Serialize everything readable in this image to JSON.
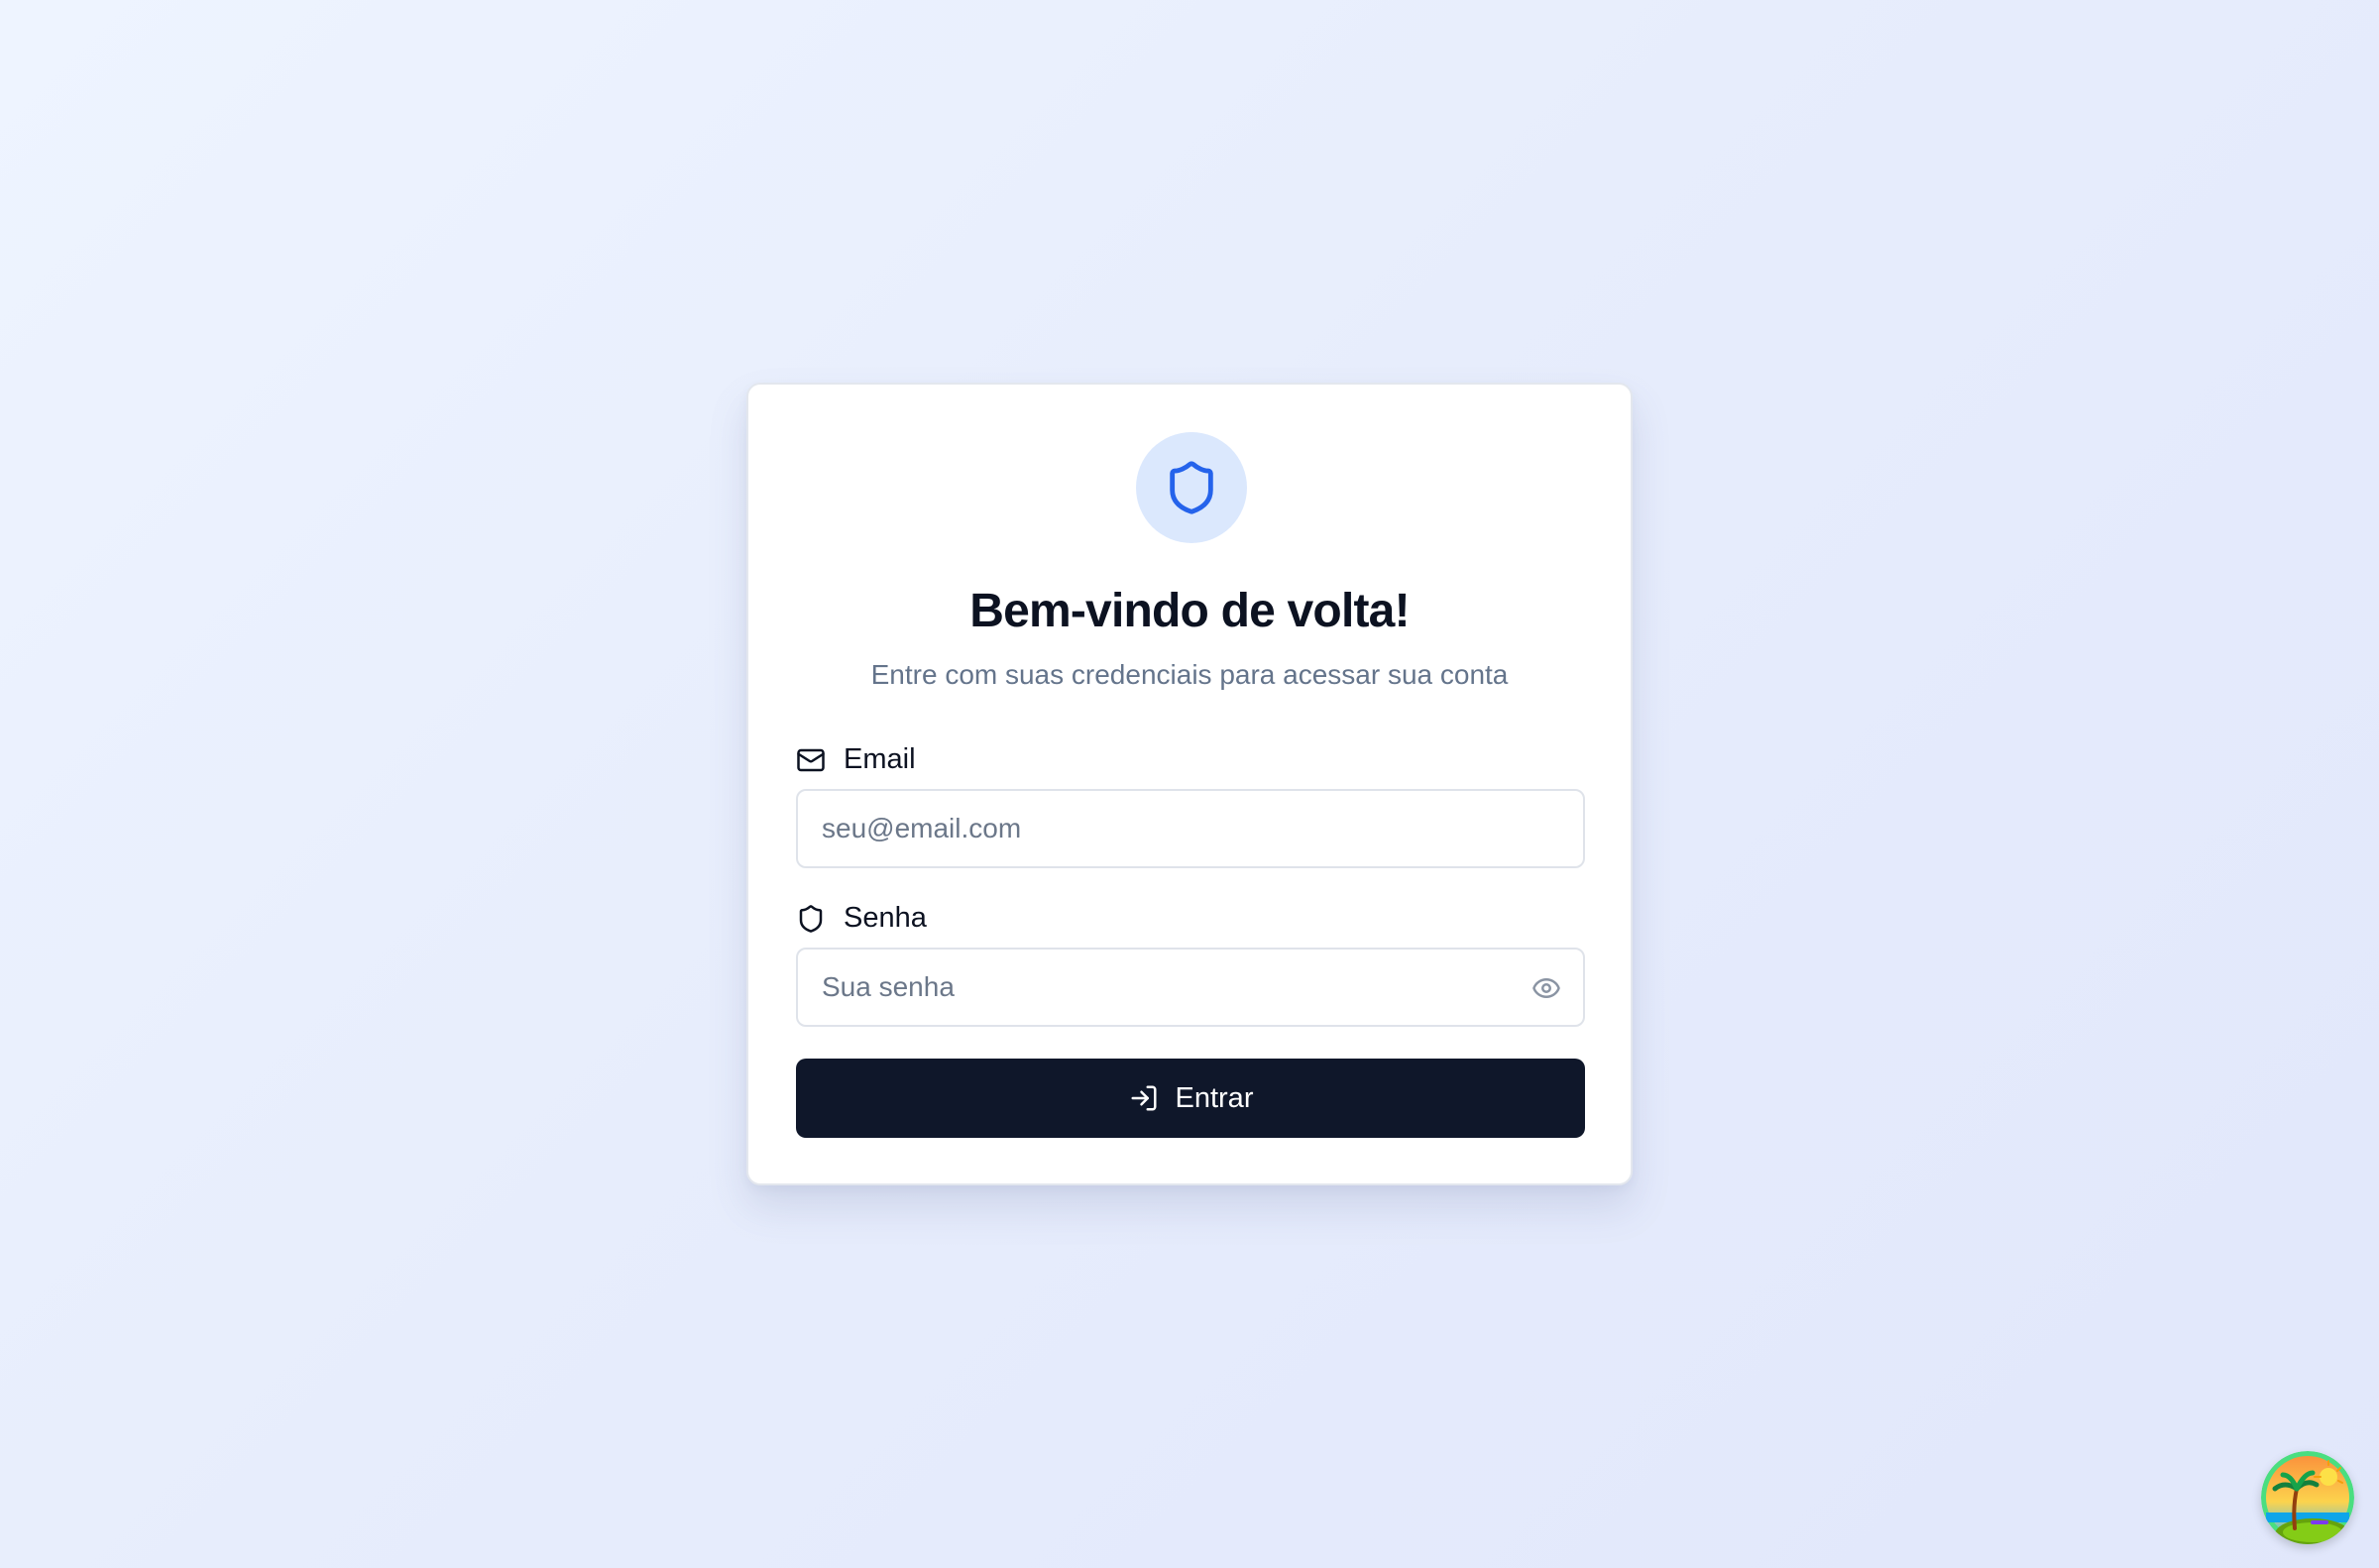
{
  "login": {
    "title": "Bem-vindo de volta!",
    "subtitle": "Entre com suas credenciais para acessar sua conta",
    "email": {
      "label": "Email",
      "placeholder": "seu@email.com",
      "icon": "mail-icon"
    },
    "password": {
      "label": "Senha",
      "placeholder": "Sua senha",
      "icon": "shield-icon",
      "toggle_icon": "eye-icon"
    },
    "submit": {
      "label": "Entrar",
      "icon": "log-in-icon"
    },
    "logo_icon": "shield-icon"
  },
  "colors": {
    "accent": "#2563eb",
    "accent_soft": "#dbe8fd",
    "button_bg": "#0f172a",
    "text_primary": "#0c1221",
    "text_muted": "#64748b"
  },
  "floating_badge": {
    "icon": "beach-island-icon"
  }
}
